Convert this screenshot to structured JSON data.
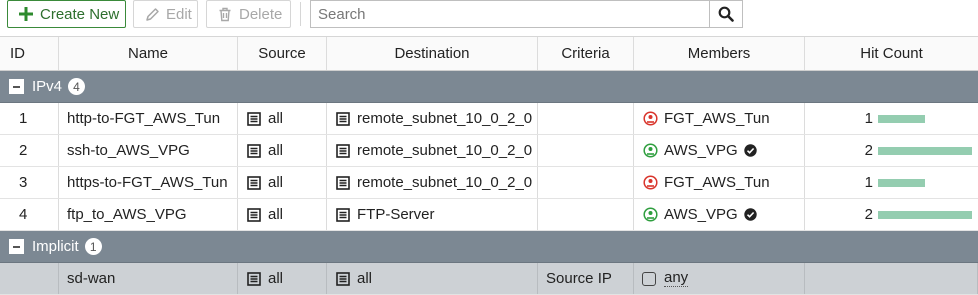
{
  "toolbar": {
    "create_label": "Create New",
    "edit_label": "Edit",
    "delete_label": "Delete",
    "search_placeholder": "Search"
  },
  "columns": [
    "ID",
    "Name",
    "Source",
    "Destination",
    "Criteria",
    "Members",
    "Hit Count"
  ],
  "groups": [
    {
      "label": "IPv4",
      "count": "4",
      "rows": [
        {
          "id": "1",
          "name": "http-to-FGT_AWS_Tun",
          "source": "all",
          "destination": "remote_subnet_10_0_2_0",
          "criteria": "",
          "member": "FGT_AWS_Tun",
          "member_status": "down",
          "verified": false,
          "hit": "1",
          "hit_fraction": 0.5
        },
        {
          "id": "2",
          "name": "ssh-to_AWS_VPG",
          "source": "all",
          "destination": "remote_subnet_10_0_2_0",
          "criteria": "",
          "member": "AWS_VPG",
          "member_status": "up",
          "verified": true,
          "hit": "2",
          "hit_fraction": 1.0
        },
        {
          "id": "3",
          "name": "https-to-FGT_AWS_Tun",
          "source": "all",
          "destination": "remote_subnet_10_0_2_0",
          "criteria": "",
          "member": "FGT_AWS_Tun",
          "member_status": "down",
          "verified": false,
          "hit": "1",
          "hit_fraction": 0.5
        },
        {
          "id": "4",
          "name": "ftp_to_AWS_VPG",
          "source": "all",
          "destination": "FTP-Server",
          "criteria": "",
          "member": "AWS_VPG",
          "member_status": "up",
          "verified": true,
          "hit": "2",
          "hit_fraction": 1.0
        }
      ]
    },
    {
      "label": "Implicit",
      "count": "1",
      "rows": [
        {
          "id": "",
          "name": "sd-wan",
          "source": "all",
          "destination": "all",
          "criteria": "Source IP",
          "member": "any",
          "hit": ""
        }
      ]
    }
  ],
  "colors": {
    "create_border": "#3a8a3a",
    "group_header": "#7c8893",
    "implicit_row": "#cdd1d5",
    "hit_bar": "#94cdb0",
    "status_down": "#d9342b",
    "status_up": "#2e9e3e"
  },
  "icons": {
    "create": "plus-icon",
    "edit": "pencil-icon",
    "delete": "trash-icon",
    "search": "magnifier-icon",
    "address": "address-list-icon",
    "member_down": "interface-down-icon",
    "member_up": "interface-up-icon",
    "verified": "check-circle-icon",
    "any": "square-icon"
  }
}
